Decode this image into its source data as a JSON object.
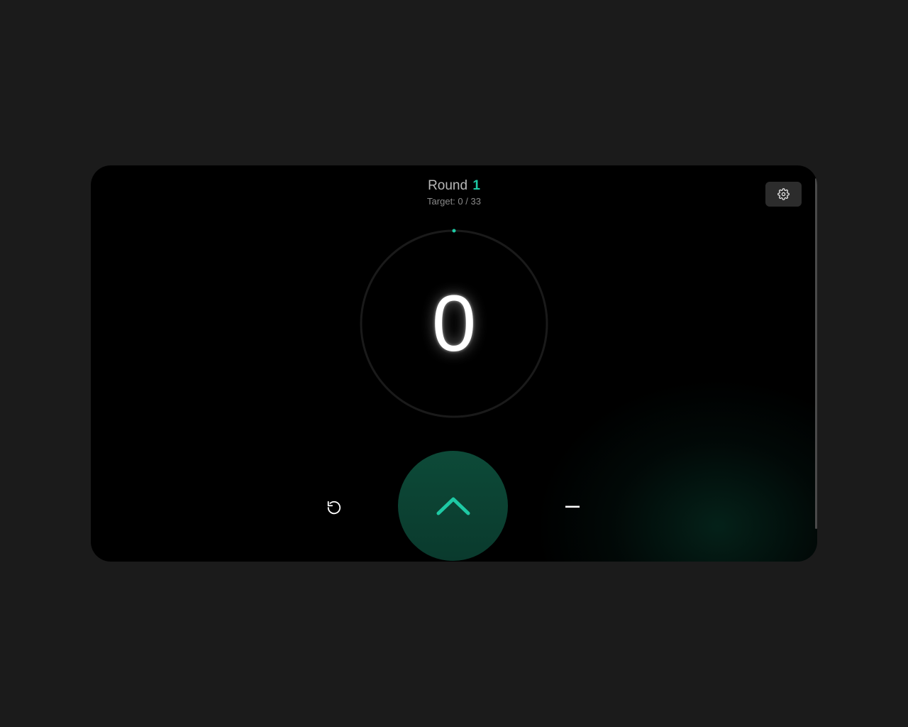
{
  "header": {
    "round_label": "Round",
    "round_number": "1",
    "target_text": "Target: 0 / 33"
  },
  "counter": {
    "value": "0",
    "target": 33,
    "progress": 0
  },
  "icons": {
    "settings": "gear-icon",
    "reset": "reset-icon",
    "increment": "chevron-up-icon",
    "decrement": "minus-icon"
  },
  "colors": {
    "page_background": "#1b1b1b",
    "card_background": "#000000",
    "accent": "#1ec9a4",
    "increment_button": "#0d4a38",
    "ring_track": "#1a1a1a"
  }
}
